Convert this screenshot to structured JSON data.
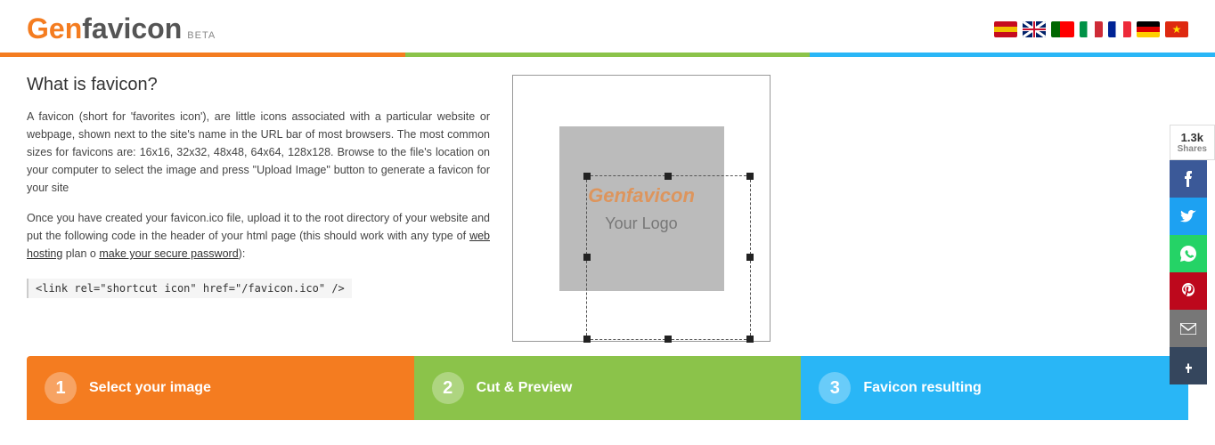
{
  "header": {
    "logo_gen": "Gen",
    "logo_favicon": "favicon",
    "logo_beta": "BETA",
    "title": "Genfavicon BETA"
  },
  "flags": [
    {
      "name": "spain-flag",
      "color": "#c60b1e"
    },
    {
      "name": "uk-flag",
      "color": "#012169"
    },
    {
      "name": "portugal-flag",
      "color": "#006600"
    },
    {
      "name": "italy-flag",
      "color": "#009246"
    },
    {
      "name": "france-flag",
      "color": "#002395"
    },
    {
      "name": "germany-flag",
      "color": "#000000"
    },
    {
      "name": "china-flag",
      "color": "#de2910"
    }
  ],
  "content": {
    "heading": "What is favicon?",
    "paragraph1": "A favicon (short for 'favorites icon'), are little icons associated with a particular website or webpage, shown next to the site's name in the URL bar of most browsers. The most common sizes for favicons are: 16x16, 32x32, 48x48, 64x64, 128x128. Browse to the file's location on your computer to select the image and press \"Upload Image\" button to generate a favicon for your site",
    "paragraph2_pre": "Once you have created your favicon.ico file, upload it to the root directory of your website and put the following code in the header of your html page (this should work with any type of",
    "link1": "web hosting",
    "paragraph2_mid": " plan o ",
    "link2": "make your secure password",
    "paragraph2_post": "):",
    "code": "<link rel=\"shortcut icon\" href=\"/favicon.ico\" />"
  },
  "preview": {
    "placeholder_gen": "Genfavicon",
    "placeholder_logo": "Your Logo"
  },
  "steps": [
    {
      "number": "1",
      "label": "Select your image"
    },
    {
      "number": "2",
      "label": "Cut & Preview"
    },
    {
      "number": "3",
      "label": "Favicon resulting"
    }
  ],
  "social": {
    "count": "1.3k",
    "shares_label": "Shares",
    "buttons": [
      {
        "name": "facebook",
        "icon": "f"
      },
      {
        "name": "twitter",
        "icon": "t"
      },
      {
        "name": "whatsapp",
        "icon": "w"
      },
      {
        "name": "pinterest",
        "icon": "p"
      },
      {
        "name": "email",
        "icon": "@"
      },
      {
        "name": "tumblr",
        "icon": "t"
      }
    ]
  }
}
